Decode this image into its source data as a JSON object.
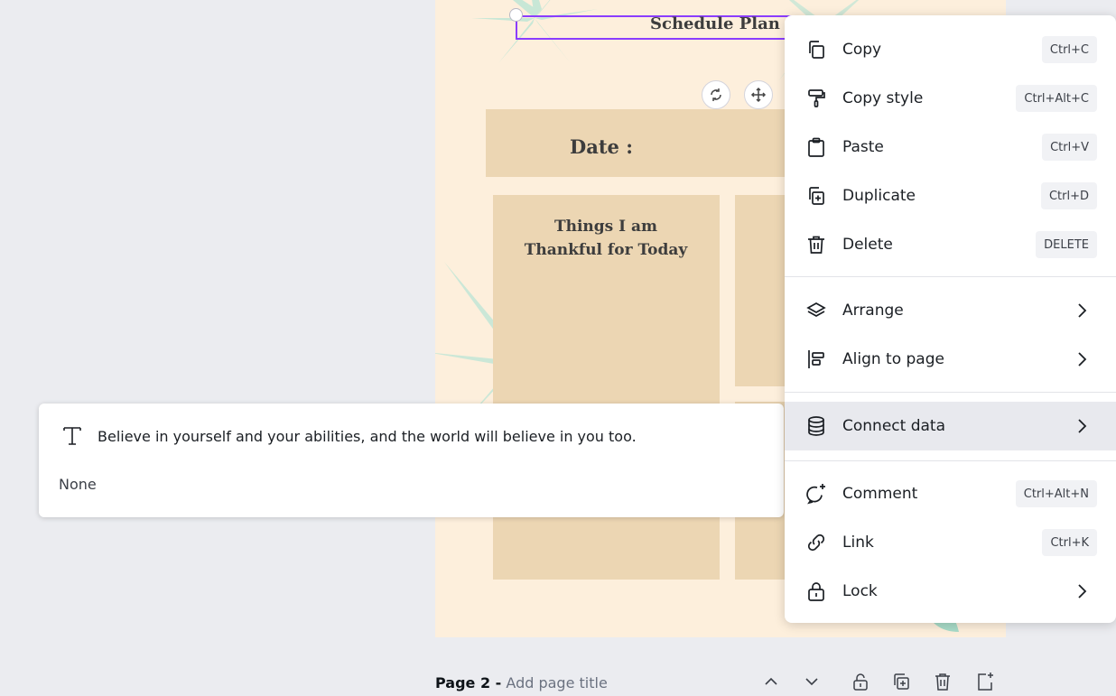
{
  "canvas": {
    "title": "Schedule Plan",
    "date_label": "Date :",
    "thankful_line1": "Things I am",
    "thankful_line2": "Thankful for Today"
  },
  "tooltip": {
    "icon": "text-icon",
    "text": "Believe in yourself and your abilities, and the world will believe in you too.",
    "subtext": "None"
  },
  "context_menu": {
    "items": [
      {
        "label": "Copy",
        "icon": "copy-icon",
        "shortcut": "Ctrl+C"
      },
      {
        "label": "Copy style",
        "icon": "paint-roller-icon",
        "shortcut": "Ctrl+Alt+C"
      },
      {
        "label": "Paste",
        "icon": "clipboard-icon",
        "shortcut": "Ctrl+V"
      },
      {
        "label": "Duplicate",
        "icon": "duplicate-icon",
        "shortcut": "Ctrl+D"
      },
      {
        "label": "Delete",
        "icon": "trash-icon",
        "shortcut": "DELETE"
      },
      {
        "label": "Arrange",
        "icon": "layers-icon",
        "submenu": true
      },
      {
        "label": "Align to page",
        "icon": "align-icon",
        "submenu": true
      },
      {
        "label": "Connect data",
        "icon": "database-icon",
        "submenu": true,
        "highlighted": true
      },
      {
        "label": "Comment",
        "icon": "comment-plus-icon",
        "shortcut": "Ctrl+Alt+N"
      },
      {
        "label": "Link",
        "icon": "link-icon",
        "shortcut": "Ctrl+K"
      },
      {
        "label": "Lock",
        "icon": "lock-icon",
        "submenu": true
      }
    ]
  },
  "page_bar": {
    "page_label": "Page 2 -",
    "title_placeholder": "Add page title"
  },
  "colors": {
    "accent": "#8b3dff",
    "canvas_bg": "#fdefdc",
    "box_fill": "#ecd6b3",
    "menu_highlight": "#e8e9ee"
  }
}
